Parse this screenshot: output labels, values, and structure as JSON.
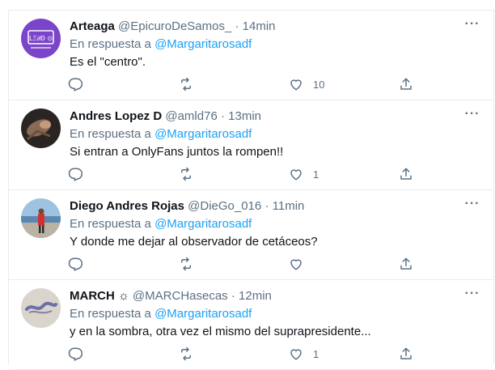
{
  "reply_prefix": "En respuesta a",
  "icons": {
    "reply": "reply-icon",
    "retweet": "retweet-icon",
    "like": "heart-icon",
    "share": "share-icon",
    "more": "more-icon"
  },
  "colors": {
    "link": "#1da1f2",
    "secondary": "#5b7083",
    "text": "#0f1419",
    "divider": "#e6ecf0"
  },
  "tweets": [
    {
      "name": "Arteaga",
      "handle": "@EpicuroDeSamos_",
      "time": "14min",
      "reply_to": "@Margaritarosadf",
      "text": "Es el \"centro\".",
      "likes": "10",
      "avatar_logo": "LΞ∂Ð ⊙"
    },
    {
      "name": "Andres Lopez D",
      "handle": "@amld76",
      "time": "13min",
      "reply_to": "@Margaritarosadf",
      "text": "Si entran a OnlyFans juntos la rompen!!",
      "likes": "1"
    },
    {
      "name": "Diego Andres Rojas",
      "handle": "@DieGo_016",
      "time": "11min",
      "reply_to": "@Margaritarosadf",
      "text": "Y donde me dejar al observador de cetáceos?",
      "likes": ""
    },
    {
      "name": "MARCH ☼",
      "handle": "@MARCHasecas",
      "time": "12min",
      "reply_to": "@Margaritarosadf",
      "text": "y en la sombra, otra vez el mismo del suprapresidente...",
      "likes": "1"
    }
  ]
}
